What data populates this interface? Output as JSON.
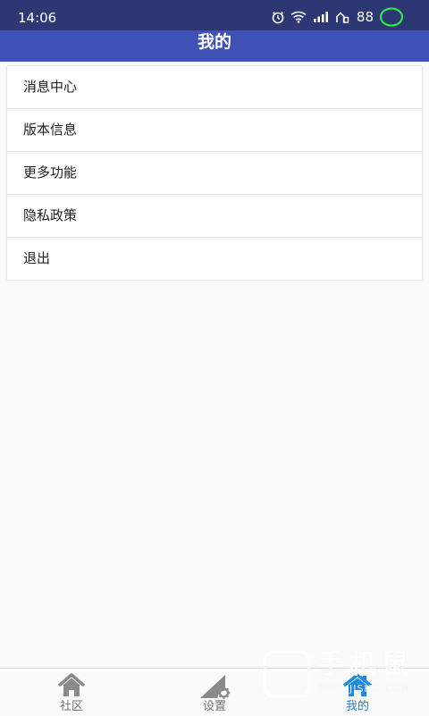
{
  "status_bar": {
    "time": "14:06",
    "battery": "88",
    "icons": [
      "alarm-icon",
      "wifi-icon",
      "signal-icon",
      "hd-signal-icon",
      "battery-ring-icon"
    ]
  },
  "header": {
    "title": "我的"
  },
  "menu": {
    "items": [
      {
        "label": "消息中心"
      },
      {
        "label": "版本信息"
      },
      {
        "label": "更多功能"
      },
      {
        "label": "隐私政策"
      },
      {
        "label": "退出"
      }
    ]
  },
  "bottom_nav": {
    "items": [
      {
        "label": "社区",
        "icon": "home-icon"
      },
      {
        "label": "设置",
        "icon": "settings-icon"
      },
      {
        "label": "我的",
        "icon": "profile-home-icon",
        "active": true
      }
    ]
  },
  "watermark": {
    "text_cn": "手机鼠",
    "text_en": "SHOUJISHU.COM"
  },
  "colors": {
    "status_bar": "#2c3773",
    "app_bar": "#3f51b5",
    "active_tab": "#1e88e5",
    "inactive_tab": "#757575",
    "battery_ring": "#2ee84a"
  }
}
